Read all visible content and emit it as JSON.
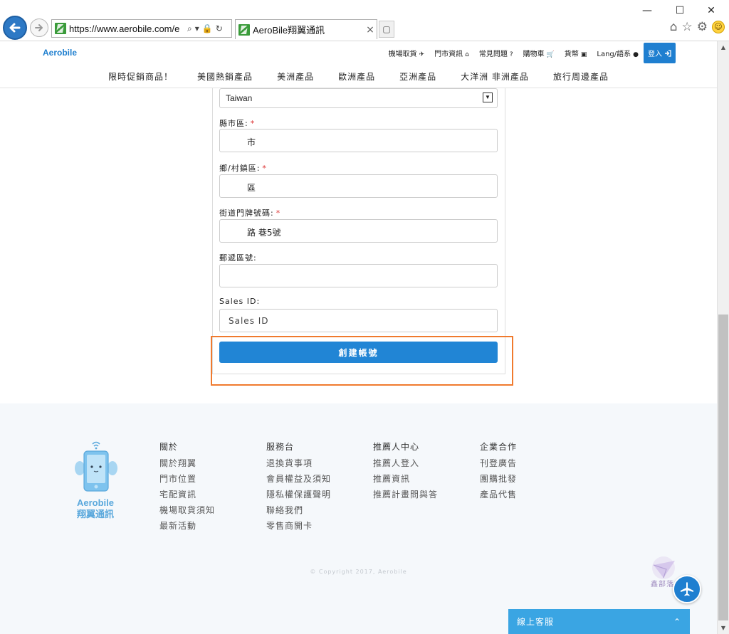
{
  "browser": {
    "url": "https://www.aerobile.com/e",
    "tab_title": "AeroBile翔翼通訊",
    "tab_close": "×",
    "window_min": "—",
    "window_max": "☐",
    "window_close": "✕"
  },
  "header": {
    "brand": "Aerobile",
    "topnav": [
      {
        "label": "機場取貨",
        "icon": "✈"
      },
      {
        "label": "門市資訊",
        "icon": "⌂"
      },
      {
        "label": "常見問題",
        "icon": "?"
      },
      {
        "label": "購物車",
        "icon": "🛒"
      },
      {
        "label": "貨幣",
        "icon": "▣"
      },
      {
        "label": "Lang/語系",
        "icon": "●"
      }
    ],
    "login_label": "登入",
    "categories": [
      "限時促銷商品！",
      "美國熱銷產品",
      "美洲產品",
      "歐洲產品",
      "亞洲產品",
      "大洋洲 非洲產品",
      "旅行周邊產品"
    ]
  },
  "form": {
    "country_value": "Taiwan",
    "city_label": "縣市區:",
    "city_value": "市",
    "district_label": "鄉/村鎮區:",
    "district_value": "區",
    "street_label": "街道門牌號碼:",
    "street_value": "路  巷5號",
    "zip_label": "郵遞區號:",
    "zip_value": "",
    "sales_label": "Sales ID:",
    "sales_placeholder": "Sales ID",
    "required_mark": "*",
    "submit_label": "創建帳號"
  },
  "footer": {
    "mascot_line1": "Aerobile",
    "mascot_line2": "翔翼通訊",
    "columns": [
      {
        "heading": "關於",
        "links": [
          "關於翔翼",
          "門市位置",
          "宅配資訊",
          "機場取貨須知",
          "最新活動"
        ]
      },
      {
        "heading": "服務台",
        "links": [
          "退換貨事項",
          "會員權益及須知",
          "隱私權保護聲明",
          "聯絡我們",
          "零售商開卡"
        ]
      },
      {
        "heading": "推薦人中心",
        "links": [
          "推薦人登入",
          "推薦資訊",
          "推薦計畫問與答"
        ]
      },
      {
        "heading": "企業合作",
        "links": [
          "刊登廣告",
          "團購批發",
          "產品代售"
        ]
      }
    ],
    "copyright": "© Copyright 2017, Aerobile",
    "watermark_text": "鑫部落",
    "chat_label": "線上客服",
    "chat_chevron": "⌃"
  },
  "colors": {
    "accent": "#2185d5",
    "highlight": "#f07a2e",
    "chat": "#3aa5e3"
  }
}
